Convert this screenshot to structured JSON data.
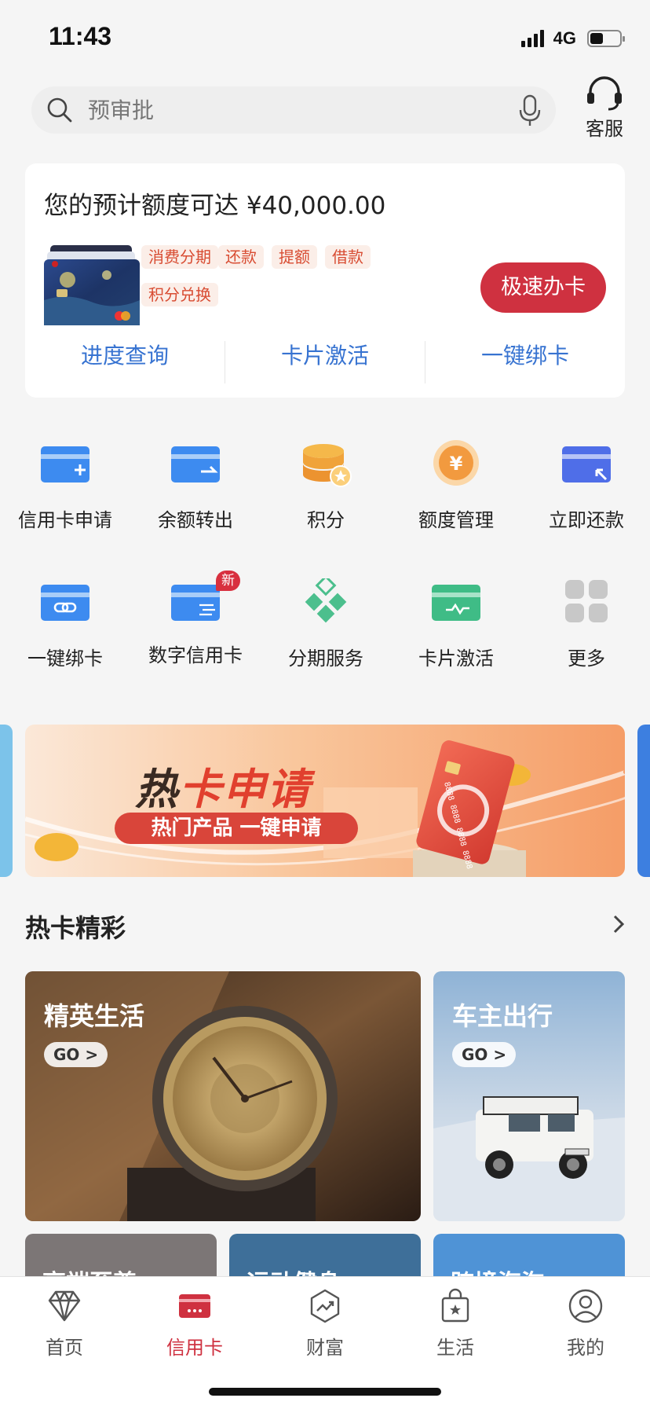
{
  "status_bar": {
    "time": "11:43",
    "network": "4G",
    "battery_level": 0.45
  },
  "search": {
    "placeholder": "预审批"
  },
  "customer_service": {
    "label": "客服"
  },
  "quota_card": {
    "title": "您的预计额度可达 ¥40,000.00",
    "chips": [
      "消费分期",
      "还款",
      "提额",
      "借款",
      "积分兑换"
    ],
    "apply_button": "极速办卡",
    "links": [
      "进度查询",
      "卡片激活",
      "一键绑卡"
    ]
  },
  "services": [
    {
      "label": "信用卡申请",
      "icon": "card-add-icon"
    },
    {
      "label": "余额转出",
      "icon": "card-transfer-icon"
    },
    {
      "label": "积分",
      "icon": "points-icon"
    },
    {
      "label": "额度管理",
      "icon": "yuan-coin-icon"
    },
    {
      "label": "立即还款",
      "icon": "card-repay-icon"
    },
    {
      "label": "一键绑卡",
      "icon": "card-link-icon"
    },
    {
      "label": "数字信用卡",
      "icon": "digital-card-icon",
      "badge": "新"
    },
    {
      "label": "分期服务",
      "icon": "installment-icon"
    },
    {
      "label": "卡片激活",
      "icon": "card-activate-icon"
    },
    {
      "label": "更多",
      "icon": "more-grid-icon"
    }
  ],
  "banner": {
    "title_part1": "热",
    "title_part2": "卡申请",
    "subtitle": "热门产品 一键申请",
    "card_number": "8888 8888 8888 8888"
  },
  "hot_section": {
    "title": "热卡精彩",
    "tiles": [
      {
        "title": "精英生活",
        "go": "GO >"
      },
      {
        "title": "车主出行",
        "go": "GO >"
      },
      {
        "title": "高端至尊"
      },
      {
        "title": "运动健身"
      },
      {
        "title": "跨境海淘"
      }
    ]
  },
  "tabbar": {
    "tabs": [
      {
        "label": "首页",
        "icon": "diamond-icon"
      },
      {
        "label": "信用卡",
        "icon": "credit-card-icon",
        "active": true
      },
      {
        "label": "财富",
        "icon": "wealth-icon"
      },
      {
        "label": "生活",
        "icon": "shopping-bag-icon"
      },
      {
        "label": "我的",
        "icon": "user-icon"
      }
    ]
  },
  "colors": {
    "accent": "#cf3140",
    "link": "#3773d1",
    "chip_text": "#d84c32"
  }
}
